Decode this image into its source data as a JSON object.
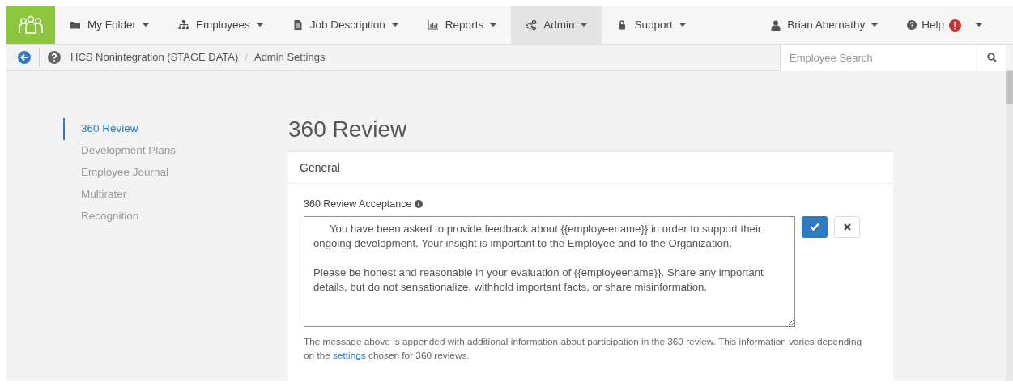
{
  "nav": {
    "items": [
      {
        "label": "My Folder",
        "selected": false
      },
      {
        "label": "Employees",
        "selected": false
      },
      {
        "label": "Job Description",
        "selected": false
      },
      {
        "label": "Reports",
        "selected": false
      },
      {
        "label": "Admin",
        "selected": true
      },
      {
        "label": "Support",
        "selected": false
      }
    ],
    "user": {
      "label": "Brian Abernathy"
    },
    "help": {
      "label": "Help",
      "alert": true
    }
  },
  "breadcrumb": {
    "items": [
      "HCS Nonintegration (STAGE DATA)",
      "Admin Settings"
    ],
    "separator": "/"
  },
  "search": {
    "placeholder": "Employee Search"
  },
  "sidebar": {
    "items": [
      {
        "label": "360 Review",
        "selected": true
      },
      {
        "label": "Development Plans",
        "selected": false
      },
      {
        "label": "Employee Journal",
        "selected": false
      },
      {
        "label": "Multirater",
        "selected": false
      },
      {
        "label": "Recognition",
        "selected": false
      }
    ]
  },
  "page_title": "360 Review",
  "card": {
    "header": "General",
    "field_label": "360 Review Acceptance",
    "value": "You have been asked to provide feedback about {{employeename}} in order to support their ongoing development. Your insight is important to the Employee and to the Organization.\n\nPlease be honest and reasonable in your evaluation of {{employeename}}. Share any important details, but do not sensationalize, withhold important facts, or share misinformation.",
    "note": {
      "before": "The message above is appended with additional information about participation in the 360 review. This information varies depending on the",
      "link": "settings",
      "after": "chosen for 360 reviews."
    }
  }
}
